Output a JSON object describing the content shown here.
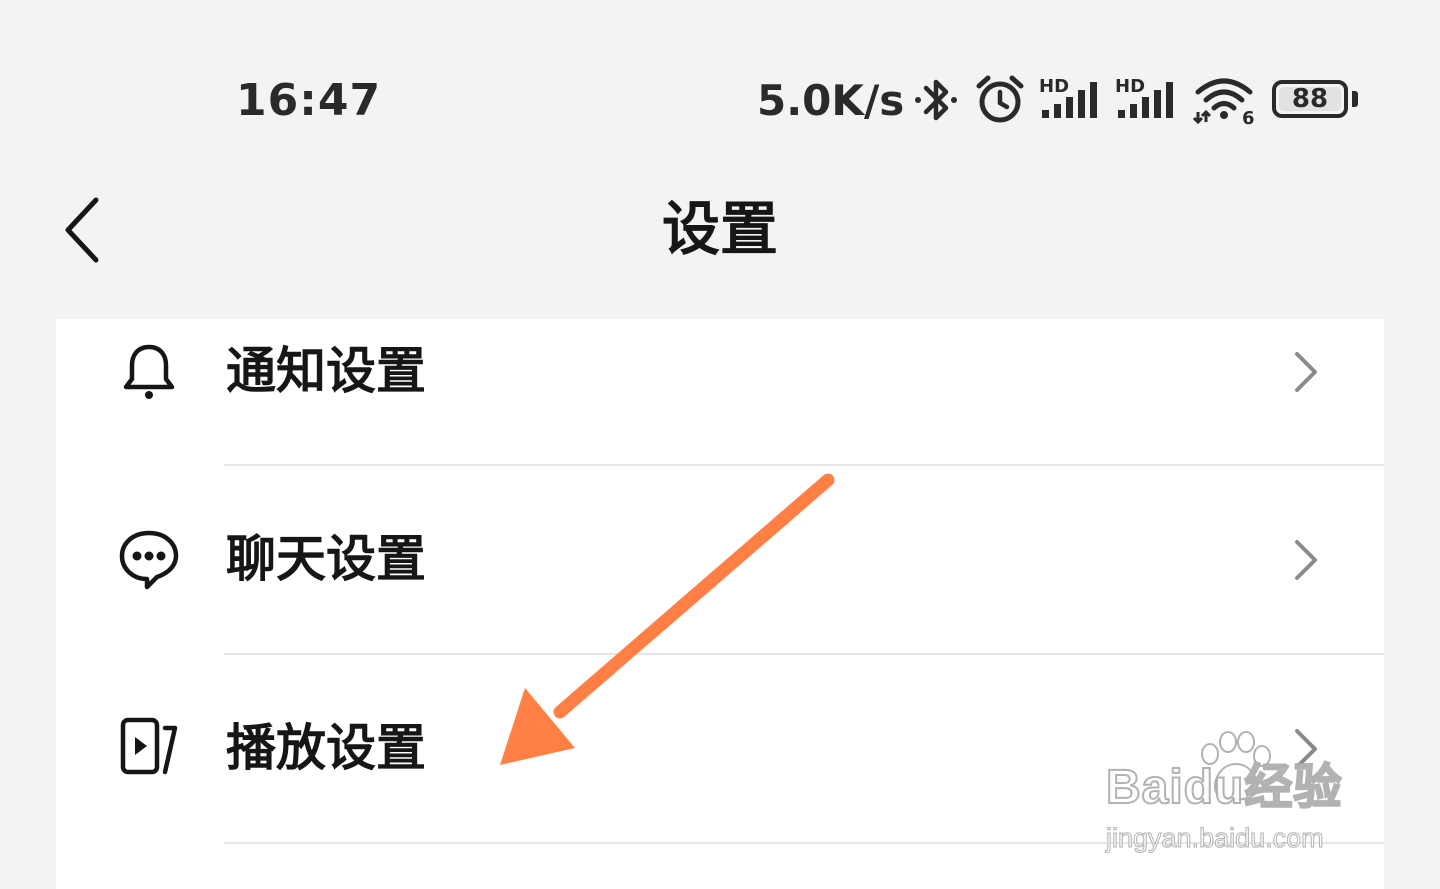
{
  "status_bar": {
    "time": "16:47",
    "net_speed": "5.0K/s",
    "battery_level": "88",
    "icons": [
      "bluetooth-icon",
      "alarm-icon",
      "hd-signal-icon",
      "hd-signal-icon",
      "wifi-icon",
      "battery-icon"
    ],
    "hd_label": "HD",
    "wifi_badge": "6"
  },
  "header": {
    "title": "设置",
    "back_icon": "chevron-left-icon"
  },
  "settings": {
    "items": [
      {
        "label": "通知设置",
        "icon": "bell-icon"
      },
      {
        "label": "聊天设置",
        "icon": "chat-bubble-icon"
      },
      {
        "label": "播放设置",
        "icon": "play-screen-icon"
      }
    ],
    "chevron_icon": "chevron-right-icon"
  },
  "annotation": {
    "arrow_color": "#ff7f45"
  },
  "watermark": {
    "brand": "Baidu经验",
    "url": "jingyan.baidu.com"
  },
  "colors": {
    "background": "#f3f3f3",
    "card": "#ffffff",
    "text": "#161616",
    "chevron": "#8a8a8a"
  }
}
